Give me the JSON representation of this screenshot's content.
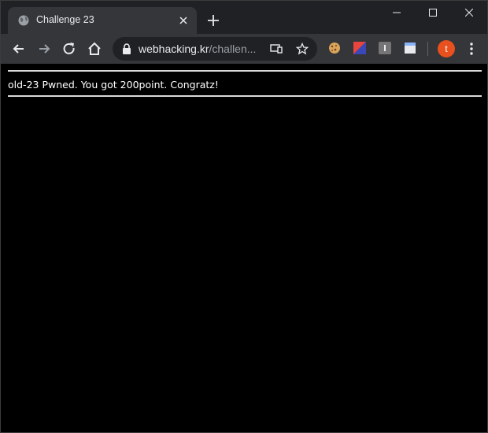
{
  "tab": {
    "title": "Challenge 23",
    "favicon": "globe-icon",
    "close": "close-icon"
  },
  "window_controls": [
    "minimize-icon",
    "maximize-icon",
    "close-icon"
  ],
  "toolbar": {
    "nav": [
      "back-arrow-icon",
      "forward-arrow-icon",
      "reload-icon",
      "home-icon"
    ],
    "omnibox": {
      "domain": "webhacking.kr",
      "path": "/challen..."
    },
    "extensions": [
      "cookie-extension-icon",
      "color-extension-icon",
      "letter-i-extension-icon",
      "window-extension-icon"
    ],
    "profile_initial": "t",
    "profile_color": "#e8501e"
  },
  "page": {
    "message": "old-23 Pwned. You got 200point. Congratz!",
    "background": "#000000",
    "text_color": "#ffffff"
  }
}
